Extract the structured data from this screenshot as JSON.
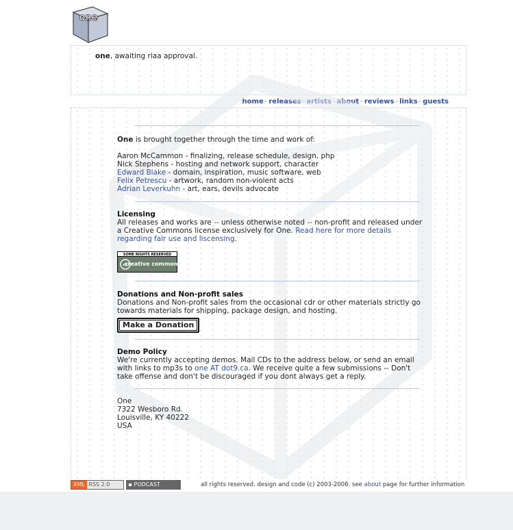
{
  "logo": {
    "text": "one"
  },
  "tagline": {
    "strong": "one",
    "rest": ", awaiting riaa approval."
  },
  "nav": {
    "items": [
      "home",
      "releases",
      "artists",
      "about",
      "reviews",
      "links",
      "guests"
    ],
    "separator": "-"
  },
  "intro": {
    "strong": "One",
    "rest": " is brought together through the time and work of:"
  },
  "credits": [
    {
      "name": "Aaron McCammon",
      "role": " - finalizing, release schedule, design, php",
      "link": false
    },
    {
      "name": "Nick Stephens",
      "role": " - hosting and network support, character",
      "link": false
    },
    {
      "name": "Edward Blake",
      "role": " - domain, inspiration, music software, web",
      "link": true
    },
    {
      "name": "Felix Petrescu",
      "role": " - artwork, random non-violent acts",
      "link": true
    },
    {
      "name": "Adrian Leverkuhn",
      "role": " - art, ears, devils advocate",
      "link": true
    }
  ],
  "licensing": {
    "title": "Licensing",
    "text": "All releases and works are -- unless otherwise noted -- non-profit and released under a Creative Commons license exclusively for One. ",
    "link": "Read here for more details regarding fair use and liscensing",
    "end": ".",
    "badge_top": "SOME RIGHTS RESERVED",
    "badge_main": "creative commons"
  },
  "donations": {
    "title": "Donations and Non-profit sales",
    "text": "Donations and Non-profit sales from the occasional cdr or other materials strictly go towards materials for shipping, package design, and hosting.",
    "button": "Make a Donation"
  },
  "demo": {
    "title": "Demo Policy",
    "text1": "We're currently accepting demos. Mail CDs to the address below, or send an email with links to mp3s to ",
    "link": "one AT dot9.ca",
    "text2": ". We receive quite a few submissions -- Don't take offense and don't be discouraged if you dont always get a reply."
  },
  "address": [
    "One",
    "7322 Wesboro Rd.",
    "Louisville, KY 40222",
    "USA"
  ],
  "footer": {
    "xml_badge_left": "XML",
    "xml_badge_right": "RSS 2.0",
    "podcast_badge": "PODCAST",
    "text_before": "all rights reserved. design and code (c) 2003-2006. see ",
    "link": "about",
    "text_after": " page for further information"
  },
  "colors": {
    "link": "#3352a6",
    "rule": "#b8c3ea",
    "background": "#eef0f3",
    "badge_orange": "#f26522"
  }
}
